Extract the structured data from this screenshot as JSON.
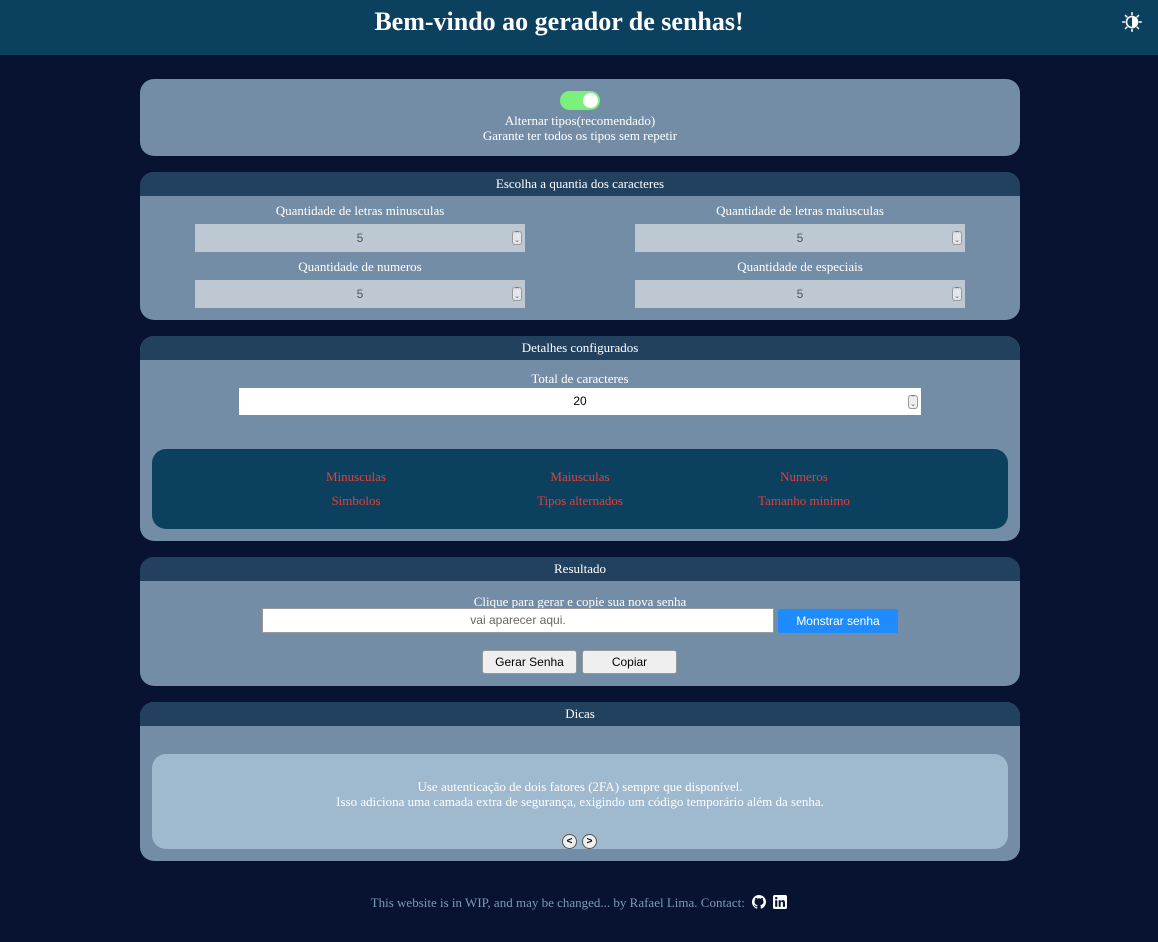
{
  "header": {
    "title": "Bem-vindo ao gerador de senhas!",
    "theme_icon": "contrast-icon"
  },
  "toggle_card": {
    "toggle_on": true,
    "label": "Alternar tipos(recomendado)",
    "description": "Garante ter todos os tipos sem repetir"
  },
  "quantity_card": {
    "title": "Escolha a quantia dos caracteres",
    "lowercase": {
      "label": "Quantidade de letras minusculas",
      "value": "5"
    },
    "uppercase": {
      "label": "Quantidade de letras maiusculas",
      "value": "5"
    },
    "numbers": {
      "label": "Quantidade de numeros",
      "value": "5"
    },
    "specials": {
      "label": "Quantidade de especiais",
      "value": "5"
    }
  },
  "details_card": {
    "title": "Detalhes configurados",
    "total_label": "Total de caracteres",
    "total_value": "20",
    "status_color": "#e2403a",
    "status": [
      "Minusculas",
      "Maiusculas",
      "Numeros",
      "Simbolos",
      "Tipos alternados",
      "Tamanho minimo"
    ]
  },
  "result_card": {
    "title": "Resultado",
    "label": "Clique para gerar e copie sua nova senha",
    "placeholder": "vai aparecer aqui.",
    "show_button": "Monstrar senha",
    "generate_button": "Gerar Senha",
    "copy_button": "Copiar"
  },
  "tips_card": {
    "title": "Dicas",
    "line1": "Use autenticação de dois fatores (2FA) sempre que disponível.",
    "line2": "Isso adiciona uma camada extra de segurança, exigindo um código temporário além da senha.",
    "prev": "<",
    "next": ">"
  },
  "footer": {
    "text": "This website is in WIP, and may be changed... by Rafael Lima. Contact:",
    "icons": [
      "github-icon",
      "linkedin-icon"
    ]
  }
}
